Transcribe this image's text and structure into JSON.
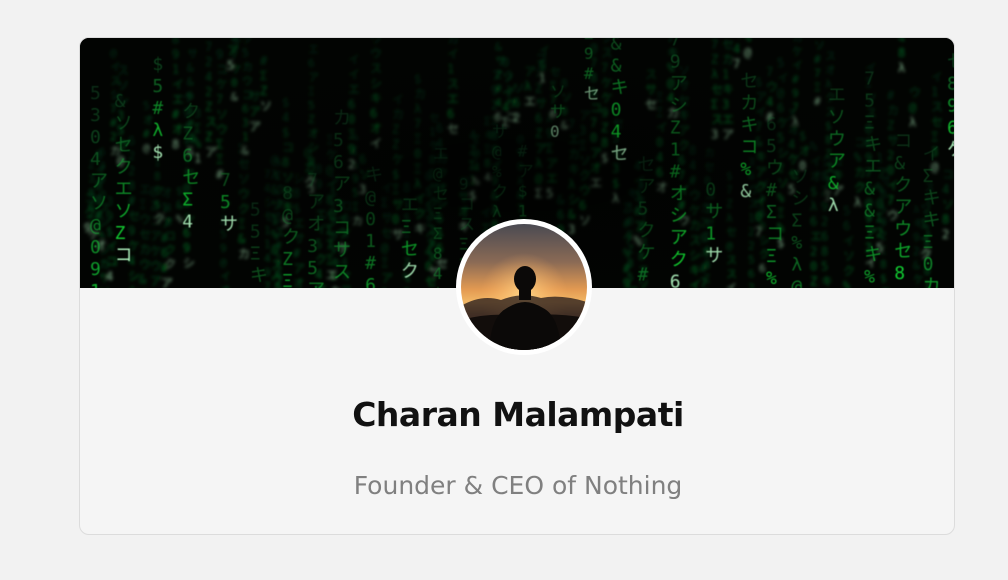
{
  "profile": {
    "name": "Charan Malampati",
    "title": "Founder & CEO of Nothing"
  },
  "banner": {
    "image": "matrix-code-rain-image",
    "accent_color": "#1fd655",
    "background_color": "#020402"
  },
  "avatar": {
    "image": "person-silhouette-sunset-image"
  },
  "colors": {
    "page_background": "#f2f2f2",
    "card_background": "#f5f5f5",
    "name_color": "#111111",
    "title_color": "#808080"
  }
}
